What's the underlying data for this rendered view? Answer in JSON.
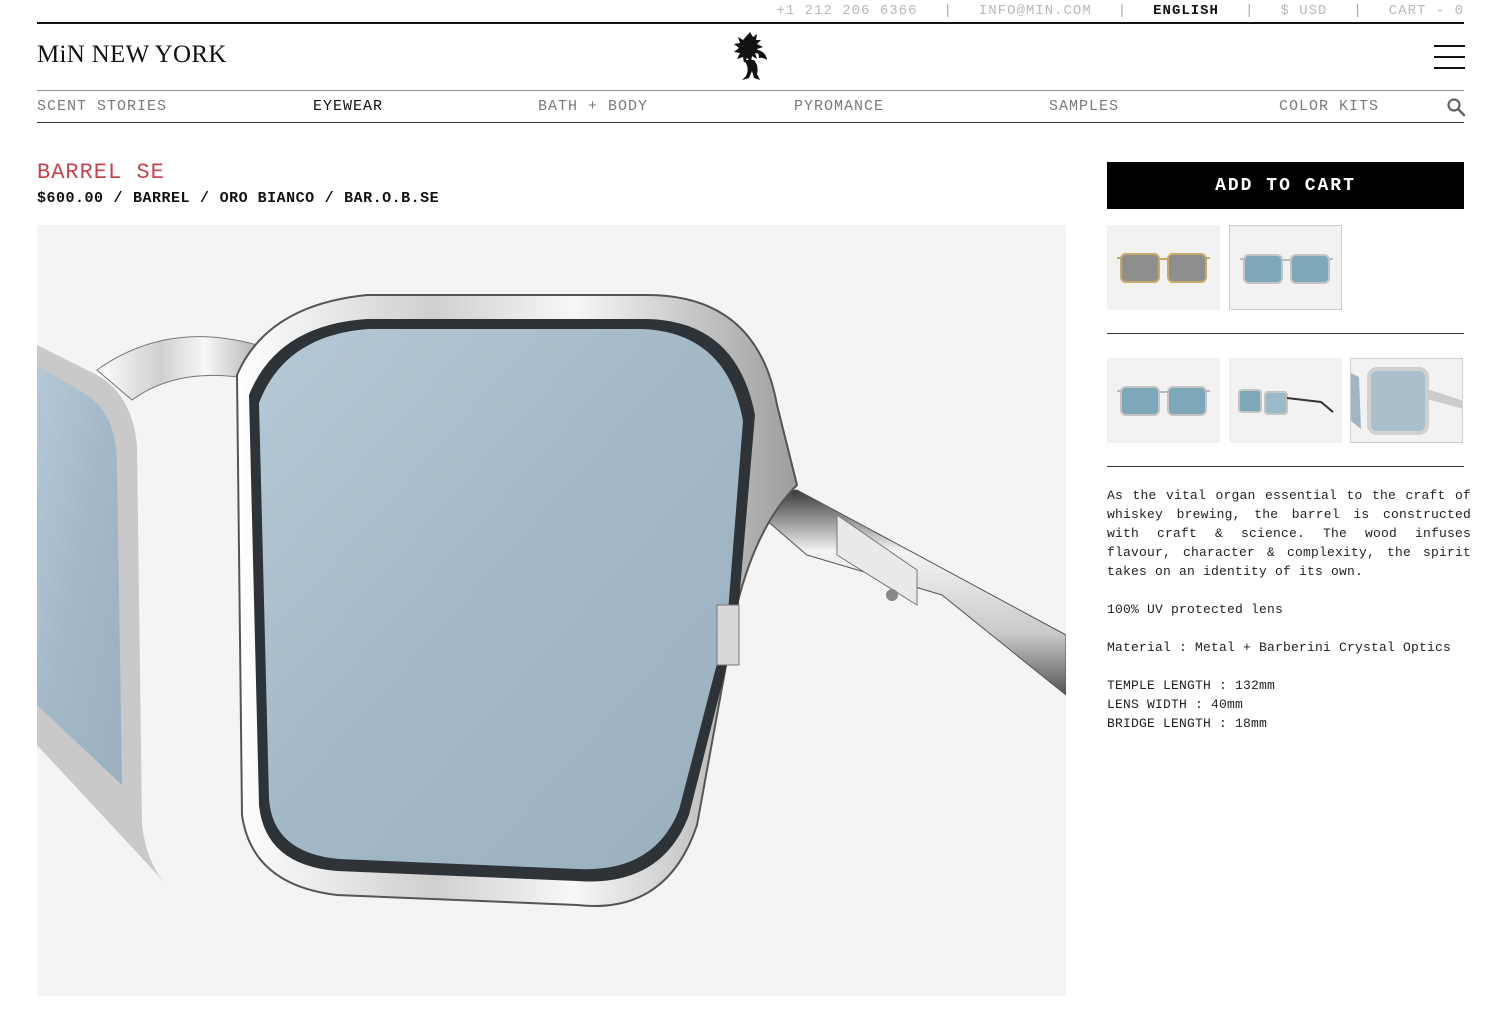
{
  "topbar": {
    "phone": "+1 212 206 6366",
    "email": "INFO@MIN.COM",
    "language": "ENGLISH",
    "currency": "$ USD",
    "cart": "CART - 0",
    "separator": "|"
  },
  "header": {
    "brand": "MiN NEW YORK",
    "crest_icon": "lion-crest-icon",
    "menu_icon": "hamburger-menu-icon"
  },
  "nav": {
    "items": [
      {
        "label": "SCENT STORIES",
        "active": false
      },
      {
        "label": "EYEWEAR",
        "active": true
      },
      {
        "label": "BATH + BODY",
        "active": false
      },
      {
        "label": "PYROMANCE",
        "active": false
      },
      {
        "label": "SAMPLES",
        "active": false
      },
      {
        "label": "COLOR KITS",
        "active": false
      }
    ],
    "search_icon": "search-icon"
  },
  "product": {
    "title": "BARREL SE",
    "price": "$600.00",
    "collection": "BARREL",
    "line": "ORO BIANCO",
    "sku": "BAR.O.B.SE",
    "meta_separator": "/",
    "title_color": "#c2434e"
  },
  "buy": {
    "add_to_cart": "ADD TO CART"
  },
  "description": {
    "story": "As the vital organ essential to the craft of whiskey brewing, the barrel is constructed with craft & science. The wood infuses flavour, character & complexity, the spirit takes on an identity of its own.",
    "uv": "100% UV protected lens",
    "material": "Material : Metal + Barberini Crystal Optics",
    "temple": "TEMPLE LENGTH : 132mm",
    "lens": "LENS WIDTH : 40mm",
    "bridge": "BRIDGE LENGTH : 18mm"
  }
}
